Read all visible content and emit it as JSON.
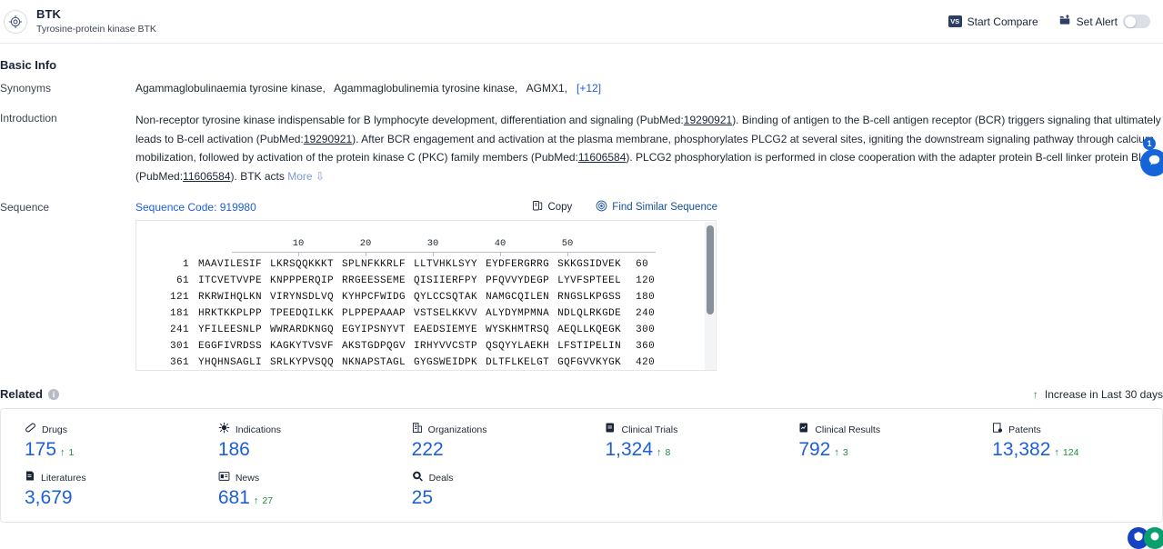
{
  "header": {
    "icon": "target-icon",
    "title": "BTK",
    "subtitle": "Tyrosine-protein kinase BTK",
    "start_compare": "Start Compare",
    "vs_label": "VS",
    "set_alert": "Set Alert"
  },
  "basic_info": {
    "section_title": "Basic Info",
    "synonyms": {
      "label": "Synonyms",
      "values": [
        "Agammaglobulinaemia tyrosine kinase,",
        "Agammaglobulinemia tyrosine kinase,",
        "AGMX1,"
      ],
      "more": "[+12]"
    },
    "introduction": {
      "label": "Introduction",
      "part1": "Non-receptor tyrosine kinase indispensable for B lymphocyte development, differentiation and signaling (PubMed:",
      "link1": "19290921",
      "part2": "). Binding of antigen to the B-cell antigen receptor (BCR) triggers signaling that ultimately leads to B-cell activation (PubMed:",
      "link2": "19290921",
      "part3": "). After BCR engagement and activation at the plasma membrane, phosphorylates PLCG2 at several sites, igniting the downstream signaling pathway through calcium mobilization, followed by activation of the protein kinase C (PKC) family members (PubMed:",
      "link3": "11606584",
      "part4": "). PLCG2 phosphorylation is performed in close cooperation with the adapter protein B-cell linker protein BLNK (PubMed:",
      "link4": "11606584",
      "part5": "). BTK acts",
      "more": "More"
    }
  },
  "sequence": {
    "label": "Sequence",
    "code_label": "Sequence Code: 919980",
    "copy_label": "Copy",
    "find_similar_label": "Find Similar Sequence",
    "ruler_ticks": [
      "10",
      "20",
      "30",
      "40",
      "50"
    ],
    "lines": [
      {
        "start": "1",
        "chunks": [
          "MAAVILESIF",
          "LKRSQQKKKT",
          "SPLNFKKRLF",
          "LLTVHKLSYY",
          "EYDFERGRRG",
          "SKKGSIDVEK"
        ],
        "end": "60"
      },
      {
        "start": "61",
        "chunks": [
          "ITCVETVVPE",
          "KNPPPERQIP",
          "RRGEESSEME",
          "QISIIERFPY",
          "PFQVVYDEGP",
          "LYVFSPTEEL"
        ],
        "end": "120"
      },
      {
        "start": "121",
        "chunks": [
          "RKRWIHQLKN",
          "VIRYNSDLVQ",
          "KYHPCFWIDG",
          "QYLCCSQTAK",
          "NAMGCQILEN",
          "RNGSLKPGSS"
        ],
        "end": "180"
      },
      {
        "start": "181",
        "chunks": [
          "HRKTKKPLPP",
          "TPEEDQILKK",
          "PLPPEPAAAP",
          "VSTSELKKVV",
          "ALYDYMPMNA",
          "NDLQLRKGDE"
        ],
        "end": "240"
      },
      {
        "start": "241",
        "chunks": [
          "YFILEESNLP",
          "WWRARDKNGQ",
          "EGYIPSNYVT",
          "EAEDSIEMYE",
          "WYSKHMTRSQ",
          "AEQLLKQEGK"
        ],
        "end": "300"
      },
      {
        "start": "301",
        "chunks": [
          "EGGFIVRDSS",
          "KAGKYTVSVF",
          "AKSTGDPQGV",
          "IRHYVVCSTP",
          "QSQYYLAEKH",
          "LFSTIPELIN"
        ],
        "end": "360"
      },
      {
        "start": "361",
        "chunks": [
          "YHQHNSAGLI",
          "SRLKYPVSQQ",
          "NKNAPSTAGL",
          "GYGSWEIDPK",
          "DLTFLKELGT",
          "GQFGVVKYGK"
        ],
        "end": "420"
      }
    ]
  },
  "related": {
    "title": "Related",
    "legend": "Increase in Last 30 days",
    "stats": [
      {
        "icon": "pill-icon",
        "label": "Drugs",
        "value": "175",
        "delta": "1"
      },
      {
        "icon": "virus-icon",
        "label": "Indications",
        "value": "186",
        "delta": ""
      },
      {
        "icon": "building-icon",
        "label": "Organizations",
        "value": "222",
        "delta": ""
      },
      {
        "icon": "clinical-trial-icon",
        "label": "Clinical Trials",
        "value": "1,324",
        "delta": "8"
      },
      {
        "icon": "clinical-result-icon",
        "label": "Clinical Results",
        "value": "792",
        "delta": "3"
      },
      {
        "icon": "patent-icon",
        "label": "Patents",
        "value": "13,382",
        "delta": "124"
      },
      {
        "icon": "literature-icon",
        "label": "Literatures",
        "value": "3,679",
        "delta": ""
      },
      {
        "icon": "news-icon",
        "label": "News",
        "value": "681",
        "delta": "27"
      },
      {
        "icon": "deals-icon",
        "label": "Deals",
        "value": "25",
        "delta": ""
      }
    ]
  },
  "floating": {
    "notification_count": "1",
    "chat_icon": "chat-bubble-icon",
    "help_icon": "help-icon",
    "feedback_icon": "feedback-icon"
  },
  "colors": {
    "link_blue": "#1e5fd8",
    "increase_green": "#1a8f3c",
    "dark_navy": "#2c3e63"
  }
}
